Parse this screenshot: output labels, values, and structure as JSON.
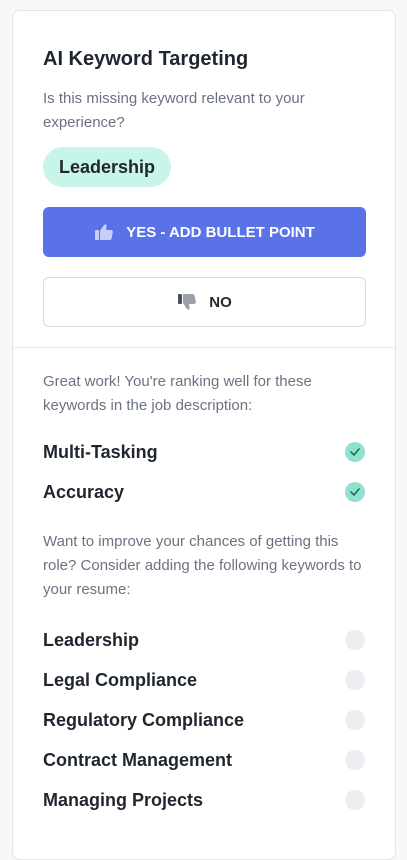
{
  "panel": {
    "title": "AI Keyword Targeting",
    "question": "Is this missing keyword relevant to your experience?",
    "current_keyword": "Leadership",
    "yes_label": "YES - ADD BULLET POINT",
    "no_label": "NO"
  },
  "ranking": {
    "message": "Great work! You're ranking well for these keywords in the job description:",
    "keywords": [
      {
        "label": "Multi-Tasking",
        "status": "matched"
      },
      {
        "label": "Accuracy",
        "status": "matched"
      }
    ]
  },
  "suggestions": {
    "message": "Want to improve your chances of getting this role? Consider adding the following keywords to your resume:",
    "keywords": [
      {
        "label": "Leadership",
        "status": "missing"
      },
      {
        "label": "Legal Compliance",
        "status": "missing"
      },
      {
        "label": "Regulatory Compliance",
        "status": "missing"
      },
      {
        "label": "Contract Management",
        "status": "missing"
      },
      {
        "label": "Managing Projects",
        "status": "missing"
      }
    ]
  },
  "colors": {
    "accent": "#5a72e8",
    "chip_bg": "#c9f4ea",
    "check_bg": "#8fe0cf",
    "pending_bg": "#ebedf0"
  },
  "icons": {
    "yes": "thumbs-up-icon",
    "no": "thumbs-down-icon",
    "matched": "check-circle-icon",
    "missing": "empty-circle-icon"
  }
}
